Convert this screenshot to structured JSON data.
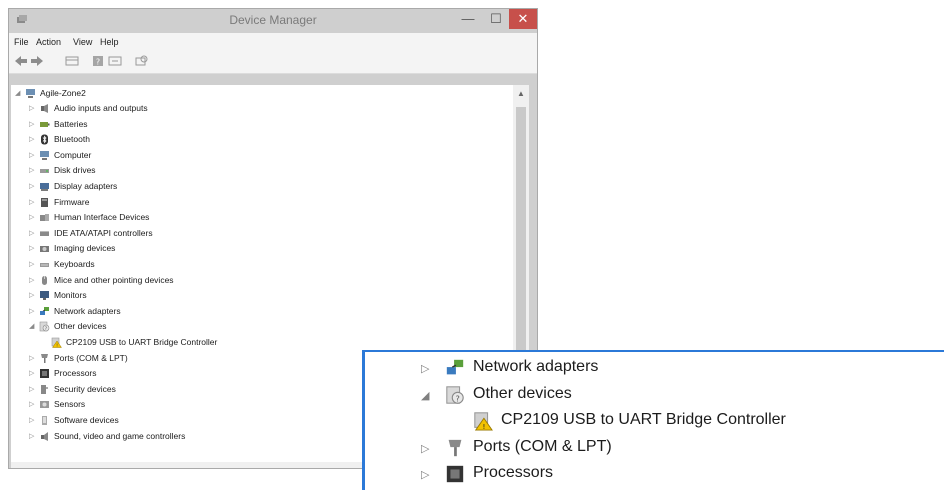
{
  "window": {
    "title": "Device Manager",
    "controls": {
      "minimize": "—",
      "maximize": "☐",
      "close": "✕"
    }
  },
  "menu": [
    "File",
    "Action",
    "View",
    "Help"
  ],
  "tree": {
    "root": "Agile-Zone2",
    "items": [
      {
        "label": "Audio inputs and outputs",
        "icon": "speaker-icon"
      },
      {
        "label": "Batteries",
        "icon": "battery-icon"
      },
      {
        "label": "Bluetooth",
        "icon": "bluetooth-icon"
      },
      {
        "label": "Computer",
        "icon": "computer-icon"
      },
      {
        "label": "Disk drives",
        "icon": "disk-drive-icon"
      },
      {
        "label": "Display adapters",
        "icon": "display-adapter-icon"
      },
      {
        "label": "Firmware",
        "icon": "firmware-icon"
      },
      {
        "label": "Human Interface Devices",
        "icon": "hid-icon"
      },
      {
        "label": "IDE ATA/ATAPI controllers",
        "icon": "ide-controller-icon"
      },
      {
        "label": "Imaging devices",
        "icon": "camera-icon"
      },
      {
        "label": "Keyboards",
        "icon": "keyboard-icon"
      },
      {
        "label": "Mice and other pointing devices",
        "icon": "mouse-icon"
      },
      {
        "label": "Monitors",
        "icon": "monitor-icon"
      },
      {
        "label": "Network adapters",
        "icon": "network-adapter-icon"
      },
      {
        "label": "Other devices",
        "icon": "unknown-device-icon",
        "expanded": true
      },
      {
        "label": "CP2109 USB to UART Bridge Controller",
        "icon": "warning-device-icon",
        "child": true
      },
      {
        "label": "Ports (COM & LPT)",
        "icon": "port-icon"
      },
      {
        "label": "Processors",
        "icon": "processor-icon"
      },
      {
        "label": "Security devices",
        "icon": "security-device-icon"
      },
      {
        "label": "Sensors",
        "icon": "sensor-icon"
      },
      {
        "label": "Software devices",
        "icon": "software-device-icon"
      },
      {
        "label": "Sound, video and game controllers",
        "icon": "sound-controller-icon"
      }
    ]
  },
  "zoom": {
    "items": [
      {
        "label": "Network adapters",
        "icon": "network-adapter-icon"
      },
      {
        "label": "Other devices",
        "icon": "unknown-device-icon",
        "expanded": true
      },
      {
        "label": "CP2109 USB to UART Bridge Controller",
        "icon": "warning-device-icon",
        "child": true
      },
      {
        "label": "Ports (COM & LPT)",
        "icon": "port-icon"
      },
      {
        "label": "Processors",
        "icon": "processor-icon"
      }
    ]
  },
  "colors": {
    "accent": "#2b79d8",
    "close": "#c7504b",
    "warning": "#f2c200"
  }
}
